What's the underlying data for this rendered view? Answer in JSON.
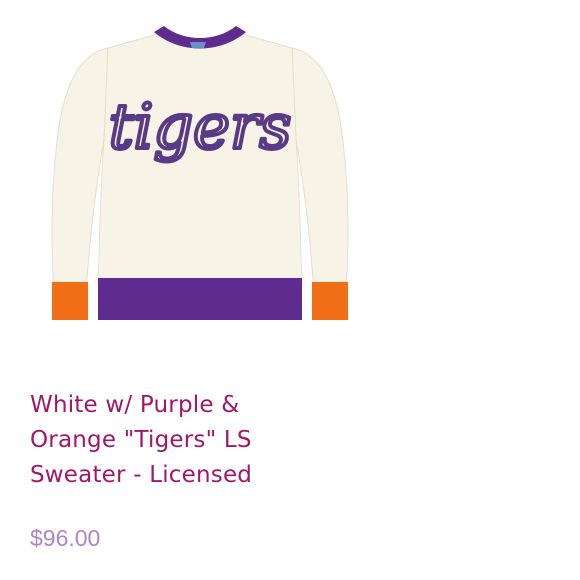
{
  "product": {
    "title": "White w/ Purple & Orange \"Tigers\" LS Sweater - Licensed",
    "price": "$96.00",
    "image_text": "tigers",
    "image_alt": "White w/ Purple & Orange \"Tigers\" LS Sweater - Licensed"
  },
  "colors": {
    "title": "#a1176a",
    "price": "#b184c4",
    "sweater_body": "#f7f3e6",
    "trim_purple": "#5e2b8f",
    "trim_orange": "#f06f17",
    "lettering_purple": "#5a3a86",
    "lettering_copper": "#c7764d"
  }
}
